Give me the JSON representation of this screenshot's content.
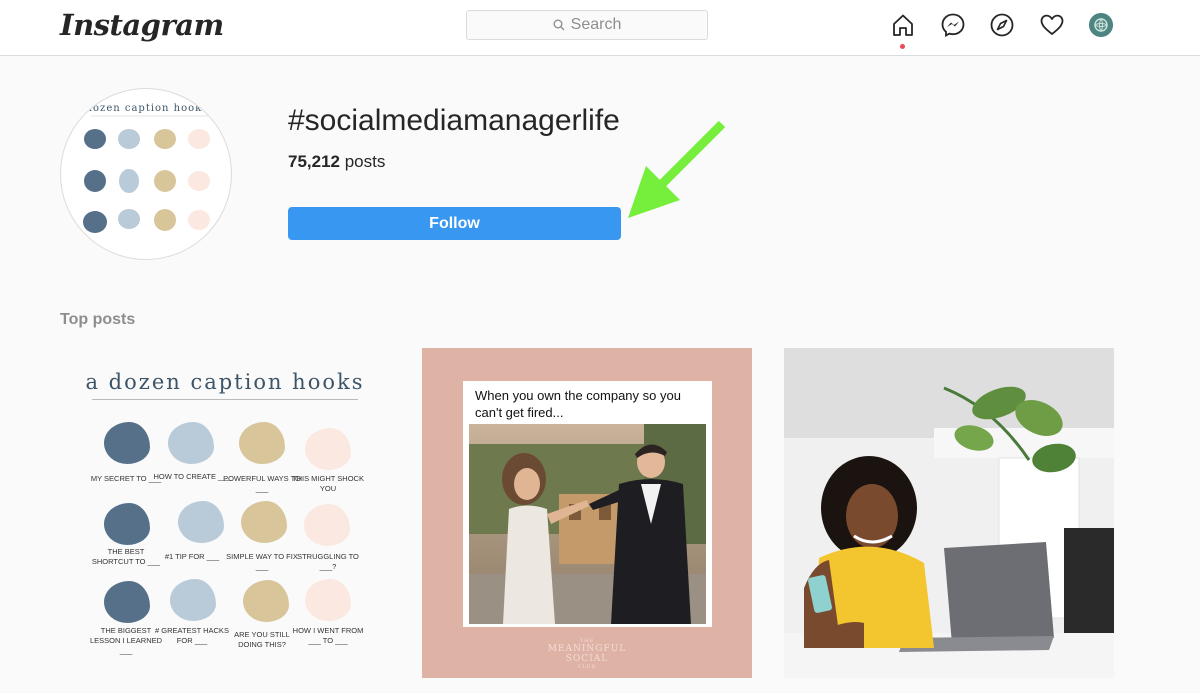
{
  "topbar": {
    "logo": "Instagram",
    "search": {
      "placeholder": "Search",
      "icon": "search-icon"
    },
    "nav_icons": [
      "home-icon",
      "messenger-icon",
      "explore-compass-icon",
      "heart-icon",
      "profile-avatar"
    ],
    "notification_dot_color": "#ed4956"
  },
  "hashtag": {
    "name": "#socialmediamanagerlife",
    "post_count": "75,212",
    "post_count_suffix": " posts",
    "follow_label": "Follow",
    "follow_color": "#3897f0",
    "annotation_arrow_color": "#76ef3c",
    "profile_image_text": "dozen caption hooks"
  },
  "top_posts": {
    "label": "Top posts",
    "post1": {
      "title": "a dozen caption hooks",
      "hooks": [
        {
          "text": "MY SECRET TO ___",
          "color": "#56708a"
        },
        {
          "text": "HOW TO CREATE ___",
          "color": "#b9cad8"
        },
        {
          "text": "POWERFUL WAYS TO ___",
          "color": "#d8c59a"
        },
        {
          "text": "THIS MIGHT SHOCK YOU",
          "color": "#fbe8e0"
        },
        {
          "text": "THE BEST SHORTCUT TO ___",
          "color": "#56708a"
        },
        {
          "text": "#1 TIP FOR ___",
          "color": "#b9cad8"
        },
        {
          "text": "SIMPLE WAY TO FIX ___",
          "color": "#d8c59a"
        },
        {
          "text": "STRUGGLING TO ___?",
          "color": "#fbe8e0"
        },
        {
          "text": "THE BIGGEST LESSON I LEARNED ___",
          "color": "#56708a"
        },
        {
          "text": "# GREATEST HACKS FOR ___",
          "color": "#b9cad8"
        },
        {
          "text": "ARE YOU STILL DOING THIS?",
          "color": "#d8c59a"
        },
        {
          "text": "HOW I WENT FROM ___ TO ___",
          "color": "#fbe8e0"
        }
      ]
    },
    "post2": {
      "caption": "When you own the company so you can't get fired...",
      "logo_small": "THE",
      "logo_line1": "MEANINGFUL",
      "logo_line2": "SOCIAL",
      "logo_small2": "CLUB"
    },
    "post3": {
      "description": "woman at desk with laptop and phone"
    }
  }
}
